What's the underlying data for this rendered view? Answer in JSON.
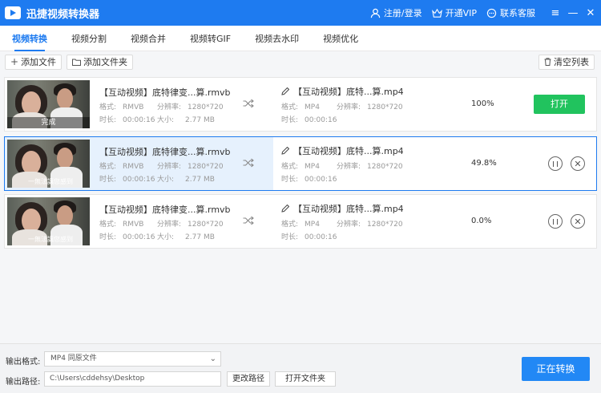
{
  "app": {
    "title": "迅捷视频转换器",
    "accent": "#1e7bf0",
    "login": "注册/登录",
    "vip": "开通VIP",
    "support": "联系客服",
    "min_glyph": "—",
    "close_glyph": "✕",
    "menu_glyph": "≡"
  },
  "tabs": [
    {
      "label": "视频转换",
      "active": true
    },
    {
      "label": "视频分割",
      "active": false
    },
    {
      "label": "视频合并",
      "active": false
    },
    {
      "label": "视频转GIF",
      "active": false
    },
    {
      "label": "视频去水印",
      "active": false
    },
    {
      "label": "视频优化",
      "active": false
    }
  ],
  "toolbar": {
    "add_file": "添加文件",
    "add_folder": "添加文件夹",
    "clear_list": "清空列表"
  },
  "labels": {
    "format": "格式:",
    "resolution": "分辨率:",
    "duration": "时长:",
    "size": "大小:"
  },
  "rows": [
    {
      "src_name": "【互动视频】底特律变...算.rmvb",
      "src_format": "RMVB",
      "src_resolution": "1280*720",
      "src_duration": "00:00:16",
      "src_size": "2.77 MB",
      "thumb_status": "完成",
      "thumb_caption": "",
      "dst_name": "【互动视频】底特...算.mp4",
      "dst_format": "MP4",
      "dst_resolution": "1280*720",
      "dst_duration": "00:00:16",
      "progress": "100%",
      "action": "打开"
    },
    {
      "src_name": "【互动视频】底特律变...算.rmvb",
      "src_format": "RMVB",
      "src_resolution": "1280*720",
      "src_duration": "00:00:16",
      "src_size": "2.77 MB",
      "thumb_status": "",
      "thumb_caption": "一無法讓您感到",
      "dst_name": "【互动视频】底特...算.mp4",
      "dst_format": "MP4",
      "dst_resolution": "1280*720",
      "dst_duration": "00:00:16",
      "progress": "49.8%"
    },
    {
      "src_name": "【互动视频】底特律变...算.rmvb",
      "src_format": "RMVB",
      "src_resolution": "1280*720",
      "src_duration": "00:00:16",
      "src_size": "2.77 MB",
      "thumb_status": "",
      "thumb_caption": "一無法讓您感到",
      "dst_name": "【互动视频】底特...算.mp4",
      "dst_format": "MP4",
      "dst_resolution": "1280*720",
      "dst_duration": "00:00:16",
      "progress": "0.0%"
    }
  ],
  "bottom": {
    "output_format_label": "输出格式:",
    "output_format_value": "MP4  同原文件",
    "output_path_label": "输出路径:",
    "output_path_value": "C:\\Users\\cddehsy\\Desktop",
    "change_path": "更改路径",
    "open_folder": "打开文件夹",
    "converting": "正在转换"
  }
}
